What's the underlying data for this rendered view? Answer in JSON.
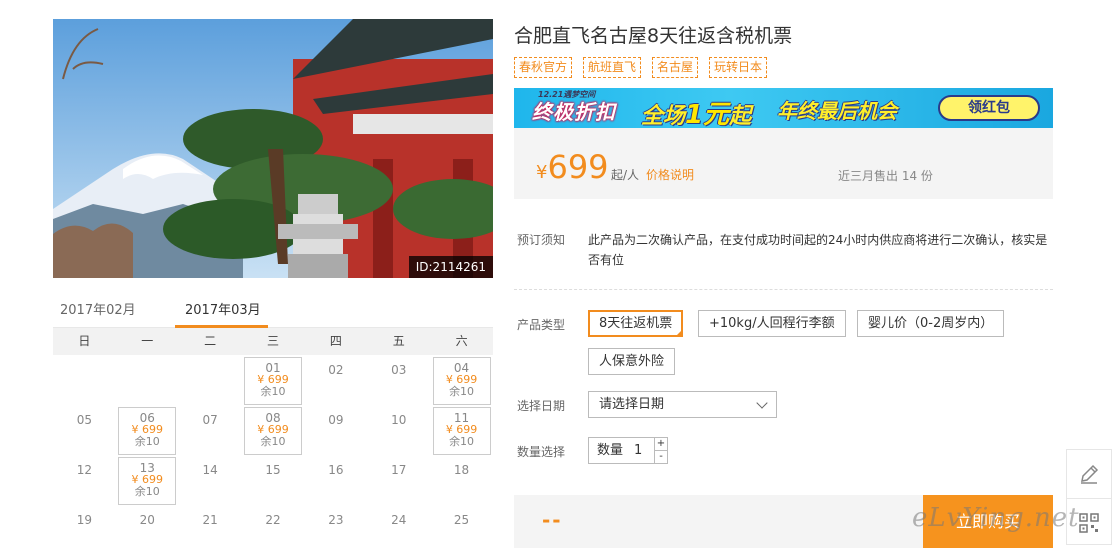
{
  "product": {
    "title": "合肥直飞名古屋8天往返含税机票",
    "tags": [
      "春秋官方",
      "航班直飞",
      "名古屋",
      "玩转日本"
    ],
    "image_id": "ID:2114261"
  },
  "banner": {
    "small_text": "12.21遇梦空间",
    "main_text": "终极折扣",
    "mid_text_pre": "全场",
    "mid_text_num": "1元",
    "mid_text_post": "起",
    "end_text": "年终最后机会",
    "button": "领红包"
  },
  "price": {
    "currency": "¥",
    "amount": "699",
    "unit": "起/人",
    "note": "价格说明",
    "sold": "近三月售出 14 份"
  },
  "notice": {
    "label": "预订须知",
    "text": "此产品为二次确认产品，在支付成功时间起的24小时内供应商将进行二次确认，核实是否有位"
  },
  "product_type": {
    "label": "产品类型",
    "options": [
      "8天往返机票",
      "+10kg/人回程行李额",
      "婴儿价（0-2周岁内）",
      "人保意外险"
    ]
  },
  "date_select": {
    "label": "选择日期",
    "placeholder": "请选择日期"
  },
  "quantity": {
    "label": "数量选择",
    "field_label": "数量",
    "value": "1",
    "plus": "+",
    "minus": "-"
  },
  "buy": {
    "total": "--",
    "button": "立即购买"
  },
  "calendar": {
    "tabs": [
      "2017年02月",
      "2017年03月"
    ],
    "weekdays": [
      "日",
      "一",
      "二",
      "三",
      "四",
      "五",
      "六"
    ],
    "price_label": "¥ 699",
    "remain_label": "余10",
    "rows": [
      [
        "",
        "",
        "",
        "01",
        "02",
        "03",
        "04"
      ],
      [
        "05",
        "06",
        "07",
        "08",
        "09",
        "10",
        "11"
      ],
      [
        "12",
        "13",
        "14",
        "15",
        "16",
        "17",
        "18"
      ],
      [
        "19",
        "20",
        "21",
        "22",
        "23",
        "24",
        "25"
      ]
    ],
    "available": [
      "01",
      "04",
      "06",
      "08",
      "11",
      "13"
    ]
  },
  "watermark": "eLvYing.net"
}
